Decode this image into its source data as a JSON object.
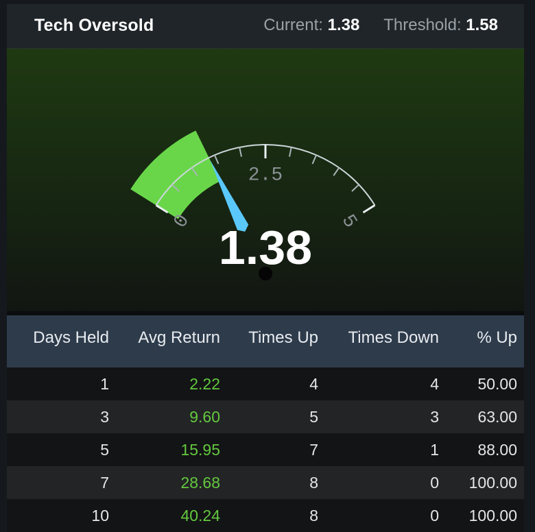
{
  "header": {
    "title": "Tech Oversold",
    "current_label": "Current:",
    "current_value": "1.38",
    "threshold_label": "Threshold:",
    "threshold_value": "1.58"
  },
  "gauge": {
    "min": 0,
    "max": 5,
    "value": 1.38,
    "threshold": 1.58,
    "value_label": "1.38",
    "tick_labels": [
      "0",
      "2.5",
      "5"
    ],
    "colors": {
      "band": "#69d64a",
      "needle": "#5ac8fa",
      "arc": "#cfd8dc"
    }
  },
  "table": {
    "columns": [
      "Days Held",
      "Avg Return",
      "Times Up",
      "Times Down",
      "% Up"
    ],
    "rows": [
      [
        "1",
        "2.22",
        "4",
        "4",
        "50.00"
      ],
      [
        "3",
        "9.60",
        "5",
        "3",
        "63.00"
      ],
      [
        "5",
        "15.95",
        "7",
        "1",
        "88.00"
      ],
      [
        "7",
        "28.68",
        "8",
        "0",
        "100.00"
      ],
      [
        "10",
        "40.24",
        "8",
        "0",
        "100.00"
      ]
    ],
    "colors": {
      "positive": "#63c93f"
    }
  }
}
